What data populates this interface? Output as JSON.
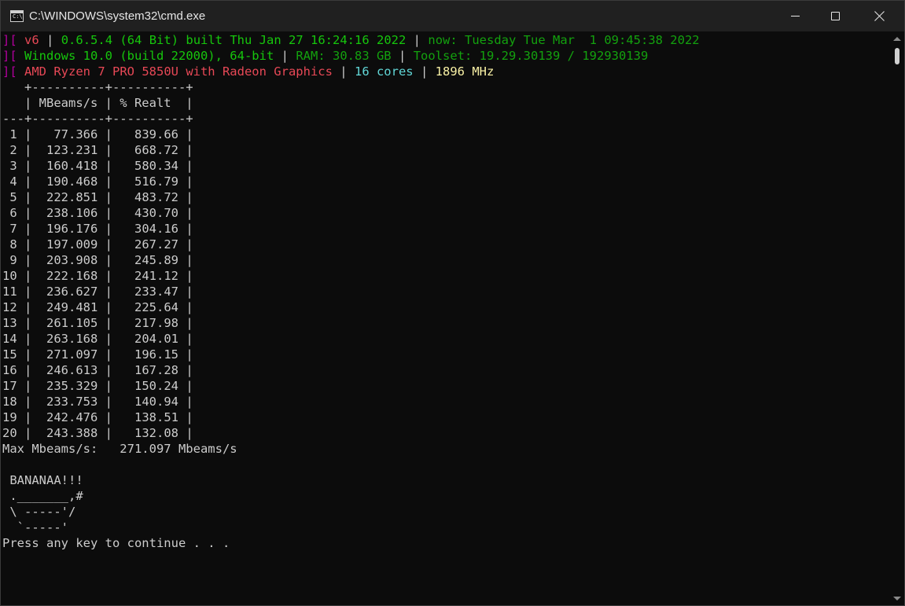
{
  "window": {
    "title": "C:\\WINDOWS\\system32\\cmd.exe",
    "icon": "cmd-icon",
    "icon_text": "C:\\"
  },
  "header": {
    "line1": {
      "prefix": "][",
      "version": "v6",
      "sep1": "|",
      "build": "0.6.5.4 (64 Bit) built Thu Jan 27 16:24:16 2022",
      "sep2": "|",
      "now": "now: Tuesday Tue Mar  1 09:45:38 2022"
    },
    "line2": {
      "prefix": "][",
      "os": "Windows 10.0 (build 22000), 64-bit",
      "sep1": "|",
      "ram": "RAM: 30.83 GB",
      "sep2": "|",
      "toolset": "Toolset: 19.29.30139 / 192930139"
    },
    "line3": {
      "prefix": "][",
      "cpu": "AMD Ryzen 7 PRO 5850U with Radeon Graphics",
      "sep1": "|",
      "cores": "16 cores",
      "sep2": "|",
      "mhz": "1896 MHz"
    }
  },
  "table": {
    "border_top": "   +----------+----------+",
    "header_row": "   | MBeams/s | % Realt  |",
    "border_mid": "---+----------+----------+",
    "columns": [
      "MBeams/s",
      "% Realt"
    ],
    "rows": [
      {
        "thread": "1",
        "mbeams": "77.366",
        "realt": "839.66"
      },
      {
        "thread": "2",
        "mbeams": "123.231",
        "realt": "668.72"
      },
      {
        "thread": "3",
        "mbeams": "160.418",
        "realt": "580.34"
      },
      {
        "thread": "4",
        "mbeams": "190.468",
        "realt": "516.79"
      },
      {
        "thread": "5",
        "mbeams": "222.851",
        "realt": "483.72"
      },
      {
        "thread": "6",
        "mbeams": "238.106",
        "realt": "430.70"
      },
      {
        "thread": "7",
        "mbeams": "196.176",
        "realt": "304.16"
      },
      {
        "thread": "8",
        "mbeams": "197.009",
        "realt": "267.27"
      },
      {
        "thread": "9",
        "mbeams": "203.908",
        "realt": "245.89"
      },
      {
        "thread": "10",
        "mbeams": "222.168",
        "realt": "241.12"
      },
      {
        "thread": "11",
        "mbeams": "236.627",
        "realt": "233.47"
      },
      {
        "thread": "12",
        "mbeams": "249.481",
        "realt": "225.64"
      },
      {
        "thread": "13",
        "mbeams": "261.105",
        "realt": "217.98"
      },
      {
        "thread": "14",
        "mbeams": "263.168",
        "realt": "204.01"
      },
      {
        "thread": "15",
        "mbeams": "271.097",
        "realt": "196.15"
      },
      {
        "thread": "16",
        "mbeams": "246.613",
        "realt": "167.28"
      },
      {
        "thread": "17",
        "mbeams": "235.329",
        "realt": "150.24"
      },
      {
        "thread": "18",
        "mbeams": "233.753",
        "realt": "140.94"
      },
      {
        "thread": "19",
        "mbeams": "242.476",
        "realt": "138.51"
      },
      {
        "thread": "20",
        "mbeams": "243.388",
        "realt": "132.08"
      }
    ]
  },
  "summary": {
    "max": "Max Mbeams/s:   271.097 Mbeams/s"
  },
  "banana": {
    "lines": [
      "",
      " BANANAA!!!",
      " ._______,#",
      " \\ -----'/",
      "  `-----'"
    ]
  },
  "prompt": "Press any key to continue . . .",
  "colors": {
    "magenta": "#b4009e",
    "red": "#e74856",
    "green": "#13a10e",
    "light_green": "#16c60c",
    "yellow": "#f9f1a5",
    "cyan": "#61d6d6",
    "white": "#cccccc",
    "background": "#0c0c0c"
  }
}
